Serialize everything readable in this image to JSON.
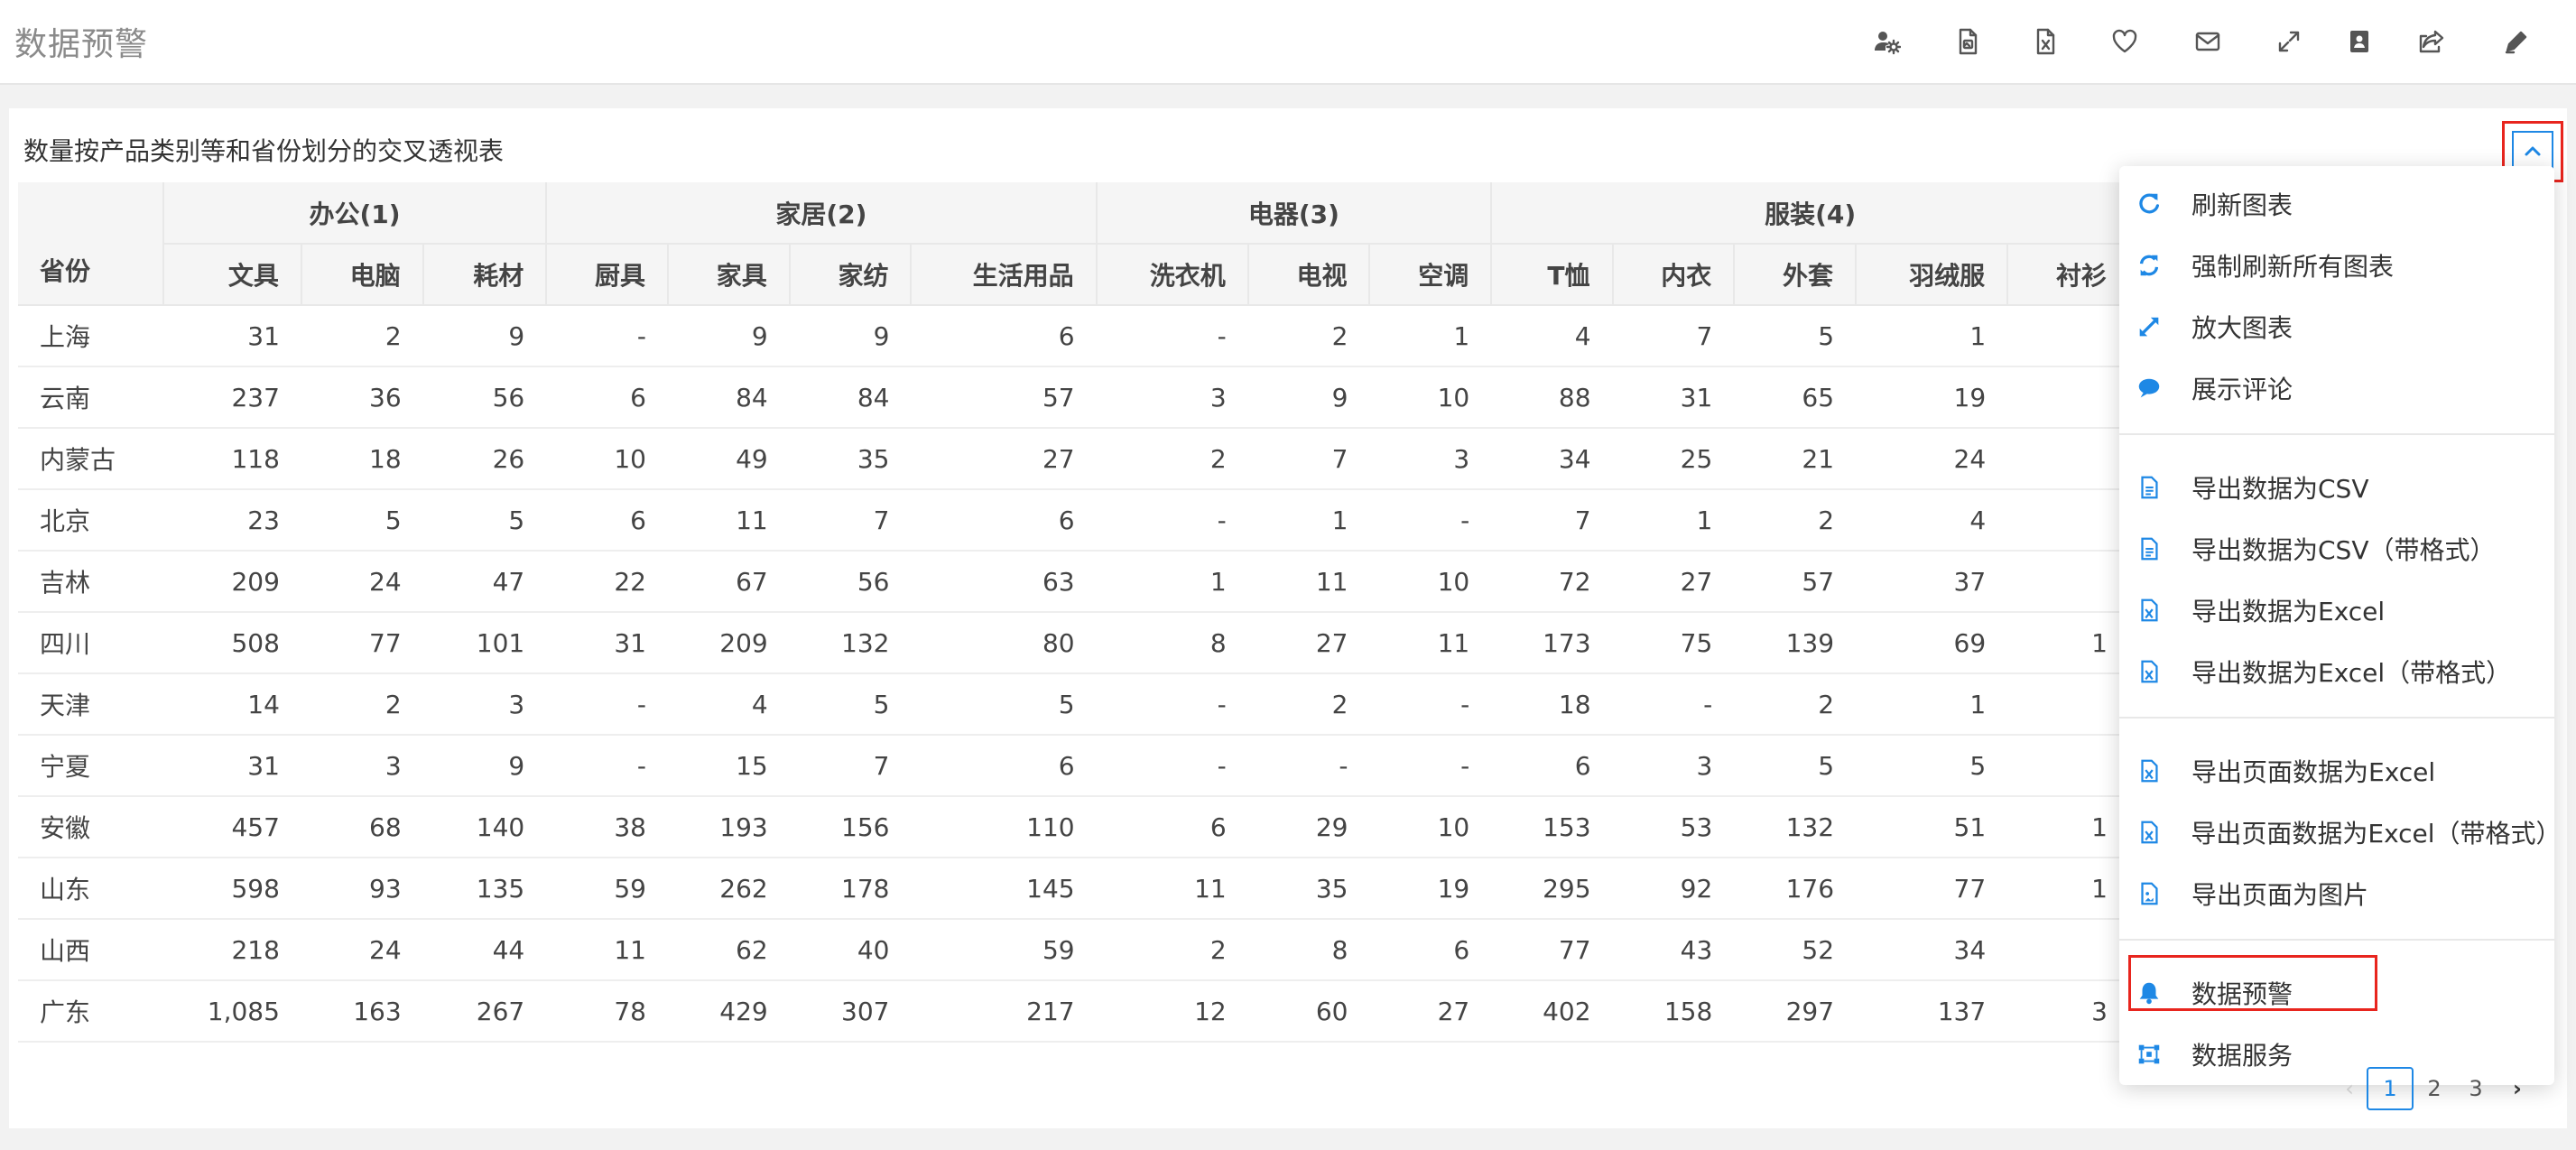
{
  "header": {
    "title": "数据预警"
  },
  "toolbar": {
    "icons": [
      "user-settings-icon",
      "document-image-icon",
      "excel-file-icon",
      "heart-icon",
      "mail-icon",
      "expand-icon",
      "contact-card-icon",
      "share-icon",
      "edit-pencil-icon"
    ]
  },
  "card": {
    "title": "数量按产品类别等和省份划分的交叉透视表",
    "collapse_icon": "chevron-up-icon"
  },
  "table": {
    "row_header": "省份",
    "groups": [
      {
        "label": "办公(1)",
        "span": 3
      },
      {
        "label": "家居(2)",
        "span": 4
      },
      {
        "label": "电器(3)",
        "span": 3
      },
      {
        "label": "服装(4)",
        "span": 6
      }
    ],
    "columns": [
      "文具",
      "电脑",
      "耗材",
      "厨具",
      "家具",
      "家纺",
      "生活用品",
      "洗衣机",
      "电视",
      "空调",
      "T恤",
      "内衣",
      "外套",
      "羽绒服",
      "衬衫"
    ],
    "rows": [
      {
        "province": "上海",
        "values": [
          "31",
          "2",
          "9",
          "-",
          "9",
          "9",
          "6",
          "-",
          "2",
          "1",
          "4",
          "7",
          "5",
          "1",
          ""
        ]
      },
      {
        "province": "云南",
        "values": [
          "237",
          "36",
          "56",
          "6",
          "84",
          "84",
          "57",
          "3",
          "9",
          "10",
          "88",
          "31",
          "65",
          "19",
          ""
        ]
      },
      {
        "province": "内蒙古",
        "values": [
          "118",
          "18",
          "26",
          "10",
          "49",
          "35",
          "27",
          "2",
          "7",
          "3",
          "34",
          "25",
          "21",
          "24",
          ""
        ]
      },
      {
        "province": "北京",
        "values": [
          "23",
          "5",
          "5",
          "6",
          "11",
          "7",
          "6",
          "-",
          "1",
          "-",
          "7",
          "1",
          "2",
          "4",
          ""
        ]
      },
      {
        "province": "吉林",
        "values": [
          "209",
          "24",
          "47",
          "22",
          "67",
          "56",
          "63",
          "1",
          "11",
          "10",
          "72",
          "27",
          "57",
          "37",
          ""
        ]
      },
      {
        "province": "四川",
        "values": [
          "508",
          "77",
          "101",
          "31",
          "209",
          "132",
          "80",
          "8",
          "27",
          "11",
          "173",
          "75",
          "139",
          "69",
          "1"
        ]
      },
      {
        "province": "天津",
        "values": [
          "14",
          "2",
          "3",
          "-",
          "4",
          "5",
          "5",
          "-",
          "2",
          "-",
          "18",
          "-",
          "2",
          "1",
          ""
        ]
      },
      {
        "province": "宁夏",
        "values": [
          "31",
          "3",
          "9",
          "-",
          "15",
          "7",
          "6",
          "-",
          "-",
          "-",
          "6",
          "3",
          "5",
          "5",
          ""
        ]
      },
      {
        "province": "安徽",
        "values": [
          "457",
          "68",
          "140",
          "38",
          "193",
          "156",
          "110",
          "6",
          "29",
          "10",
          "153",
          "53",
          "132",
          "51",
          "1"
        ]
      },
      {
        "province": "山东",
        "values": [
          "598",
          "93",
          "135",
          "59",
          "262",
          "178",
          "145",
          "11",
          "35",
          "19",
          "295",
          "92",
          "176",
          "77",
          "1"
        ]
      },
      {
        "province": "山西",
        "values": [
          "218",
          "24",
          "44",
          "11",
          "62",
          "40",
          "59",
          "2",
          "8",
          "6",
          "77",
          "43",
          "52",
          "34",
          ""
        ]
      },
      {
        "province": "广东",
        "values": [
          "1,085",
          "163",
          "267",
          "78",
          "429",
          "307",
          "217",
          "12",
          "60",
          "27",
          "402",
          "158",
          "297",
          "137",
          "3"
        ]
      }
    ]
  },
  "menu": {
    "items": [
      {
        "label": "刷新图表",
        "icon": "refresh-icon"
      },
      {
        "label": "强制刷新所有图表",
        "icon": "sync-icon"
      },
      {
        "label": "放大图表",
        "icon": "expand-arrows-icon"
      },
      {
        "label": "展示评论",
        "icon": "comment-icon"
      },
      {
        "label": "导出数据为CSV",
        "icon": "csv-file-icon"
      },
      {
        "label": "导出数据为CSV（带格式）",
        "icon": "csv-file-icon"
      },
      {
        "label": "导出数据为Excel",
        "icon": "excel-file-icon"
      },
      {
        "label": "导出数据为Excel（带格式）",
        "icon": "excel-file-icon"
      },
      {
        "label": "导出页面数据为Excel",
        "icon": "excel-file-icon"
      },
      {
        "label": "导出页面数据为Excel（带格式）",
        "icon": "excel-file-icon"
      },
      {
        "label": "导出页面为图片",
        "icon": "image-file-icon"
      },
      {
        "label": "数据预警",
        "icon": "bell-icon"
      },
      {
        "label": "数据服务",
        "icon": "data-service-icon"
      }
    ]
  },
  "pagination": {
    "prev": "‹",
    "pages": [
      "1",
      "2",
      "3"
    ],
    "next": "›",
    "current": 1
  },
  "colors": {
    "accent": "#1e88e5",
    "highlight": "#e8251e",
    "header_bg": "#f5f5f5"
  }
}
